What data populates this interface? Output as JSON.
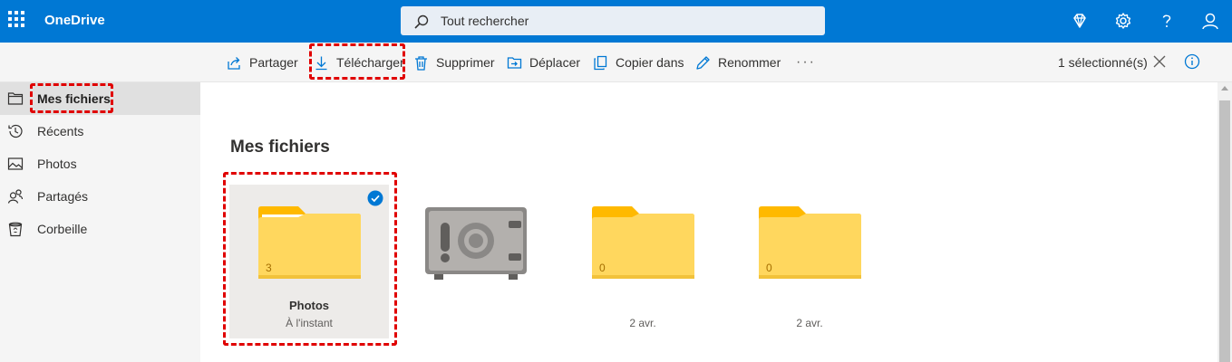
{
  "app": {
    "title": "OneDrive"
  },
  "search": {
    "placeholder": "Tout rechercher"
  },
  "toolbar": {
    "share": "Partager",
    "download": "Télécharger",
    "delete": "Supprimer",
    "move": "Déplacer",
    "copy": "Copier dans",
    "rename": "Renommer",
    "more": "···",
    "selection": "1 sélectionné(s)"
  },
  "sidebar": {
    "items": [
      {
        "label": "Mes fichiers",
        "icon": "folder-icon",
        "active": true
      },
      {
        "label": "Récents",
        "icon": "history-icon"
      },
      {
        "label": "Photos",
        "icon": "image-icon"
      },
      {
        "label": "Partagés",
        "icon": "people-icon"
      },
      {
        "label": "Corbeille",
        "icon": "recycle-bin-icon"
      }
    ]
  },
  "main": {
    "title": "Mes fichiers",
    "tiles": [
      {
        "type": "folder",
        "name": "Photos",
        "count": "3",
        "modified": "À l'instant",
        "selected": true
      },
      {
        "type": "vault",
        "name": "",
        "modified": ""
      },
      {
        "type": "folder",
        "name": "",
        "count": "0",
        "modified": "2 avr."
      },
      {
        "type": "folder",
        "name": "",
        "count": "0",
        "modified": "2 avr."
      }
    ]
  },
  "colors": {
    "brand": "#0078d4",
    "folder": "#ffd75e",
    "folder_tab": "#ffb900",
    "highlight": "#e00000"
  }
}
